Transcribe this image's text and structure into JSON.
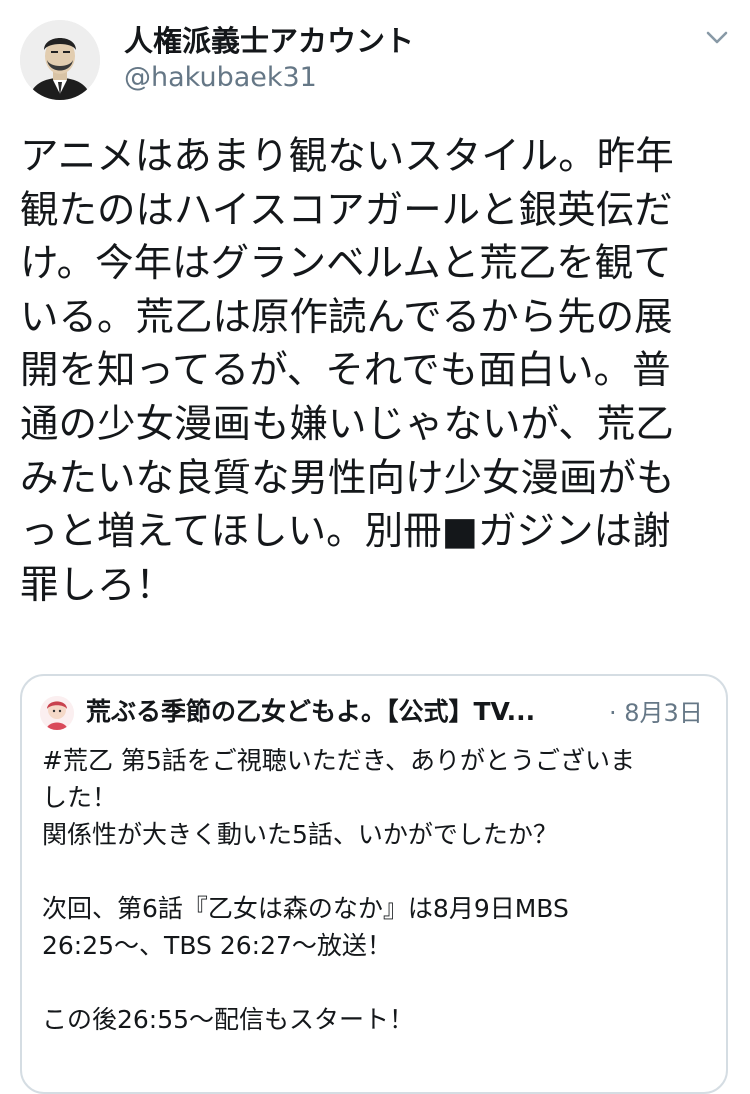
{
  "tweet": {
    "author": {
      "name": "人権派義士アカウント",
      "handle": "@hakubaek31",
      "avatar_icon": "man-portrait-avatar"
    },
    "menu_icon": "chevron-down-icon",
    "text": "アニメはあまり観ないスタイル。昨年\n観たのはハイスコアガールと銀英伝だ\nけ。今年はグランベルムと荒乙を観て\nいる。荒乙は原作読んでるから先の展\n開を知ってるが、それでも面白い。普\n通の少女漫画も嫌いじゃないが、荒乙\nみたいな良質な男性向け少女漫画がも\nっと増えてほしい。別冊■ガジンは謝\n罪しろ！"
  },
  "quoted_tweet": {
    "account_name": "荒ぶる季節の乙女どもよ。【公式】TV...",
    "separator": "·",
    "date": "8月3日",
    "avatar_icon": "anime-character-avatar",
    "text": "#荒乙 第5話をご視聴いただき、ありがとうございま\nした！\n関係性が大きく動いた5話、いかがでしたか？\n\n次回、第6話『乙女は森のなか』は8月9日MBS\n26:25〜、TBS 26:27〜放送！\n\nこの後26:55〜配信もスタート！"
  },
  "colors": {
    "text_primary": "#14171a",
    "text_secondary": "#657786",
    "card_border": "#d5dde3",
    "background": "#ffffff"
  }
}
